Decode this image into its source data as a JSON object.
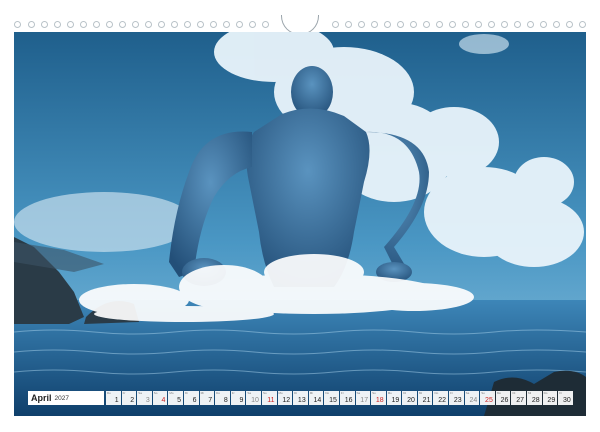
{
  "calendar": {
    "month": "April",
    "year": "2027",
    "days": [
      {
        "n": "1",
        "dow": "Do",
        "type": "normal"
      },
      {
        "n": "2",
        "dow": "Fr",
        "type": "normal"
      },
      {
        "n": "3",
        "dow": "Sa",
        "type": "weekend"
      },
      {
        "n": "4",
        "dow": "So",
        "type": "holiday"
      },
      {
        "n": "5",
        "dow": "Mo",
        "type": "normal"
      },
      {
        "n": "6",
        "dow": "Di",
        "type": "normal"
      },
      {
        "n": "7",
        "dow": "Mi",
        "type": "normal"
      },
      {
        "n": "8",
        "dow": "Do",
        "type": "normal"
      },
      {
        "n": "9",
        "dow": "Fr",
        "type": "normal"
      },
      {
        "n": "10",
        "dow": "Sa",
        "type": "weekend"
      },
      {
        "n": "11",
        "dow": "So",
        "type": "holiday"
      },
      {
        "n": "12",
        "dow": "Mo",
        "type": "normal"
      },
      {
        "n": "13",
        "dow": "Di",
        "type": "normal"
      },
      {
        "n": "14",
        "dow": "Mi",
        "type": "normal"
      },
      {
        "n": "15",
        "dow": "Do",
        "type": "normal"
      },
      {
        "n": "16",
        "dow": "Fr",
        "type": "normal"
      },
      {
        "n": "17",
        "dow": "Sa",
        "type": "weekend"
      },
      {
        "n": "18",
        "dow": "So",
        "type": "holiday"
      },
      {
        "n": "19",
        "dow": "Mo",
        "type": "normal"
      },
      {
        "n": "20",
        "dow": "Di",
        "type": "normal"
      },
      {
        "n": "21",
        "dow": "Mi",
        "type": "normal"
      },
      {
        "n": "22",
        "dow": "Do",
        "type": "normal"
      },
      {
        "n": "23",
        "dow": "Fr",
        "type": "normal"
      },
      {
        "n": "24",
        "dow": "Sa",
        "type": "weekend"
      },
      {
        "n": "25",
        "dow": "So",
        "type": "holiday"
      },
      {
        "n": "26",
        "dow": "Mo",
        "type": "normal"
      },
      {
        "n": "27",
        "dow": "Di",
        "type": "normal"
      },
      {
        "n": "28",
        "dow": "Mi",
        "type": "normal"
      },
      {
        "n": "29",
        "dow": "Do",
        "type": "normal"
      },
      {
        "n": "30",
        "dow": "Fr",
        "type": "normal"
      }
    ]
  },
  "colors": {
    "holiday": "#cc2222",
    "sky_top": "#2a6f9e",
    "sea": "#1d5f92"
  }
}
